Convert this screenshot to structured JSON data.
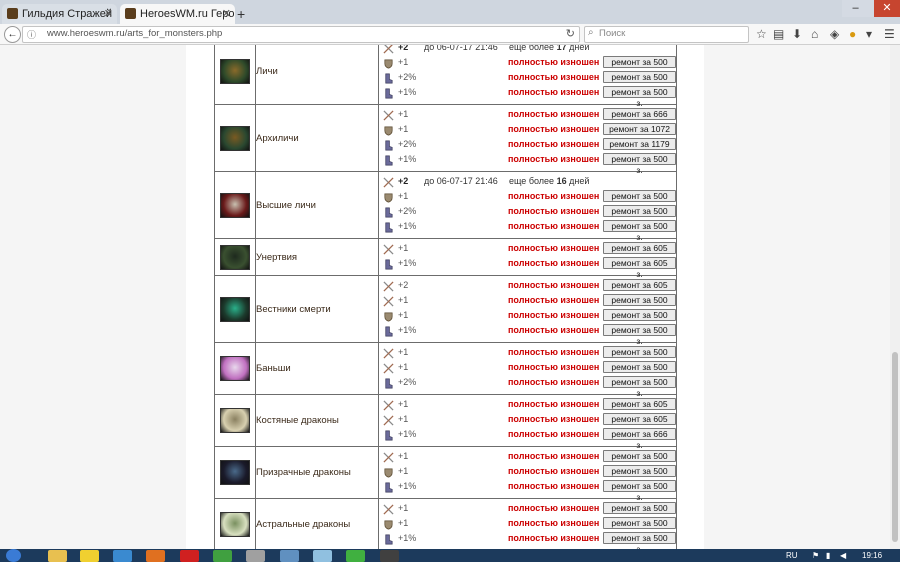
{
  "browser": {
    "tabs": [
      {
        "label": "Гильдия Стражей"
      },
      {
        "label": "HeroesWM.ru Герои войны"
      }
    ],
    "url": "www.heroeswm.ru/arts_for_monsters.php",
    "search_placeholder": "Поиск"
  },
  "taskbar": {
    "lang": "RU",
    "time": "19:16"
  },
  "monsters": [
    {
      "name": "Личи",
      "colors": [
        "#2e4a2a",
        "#8a6a2a"
      ],
      "lines": [
        {
          "icon": "sword",
          "value": "+2",
          "bold": true,
          "date": "до 06-07-17 21:46",
          "more": "еще более",
          "days": "17",
          "days_unit": "дней"
        },
        {
          "icon": "shield",
          "value": "+1",
          "wear": "полностью изношен",
          "repair": "ремонт за 500 з."
        },
        {
          "icon": "boot",
          "value": "+2%",
          "wear": "полностью изношен",
          "repair": "ремонт за 500 з."
        },
        {
          "icon": "boot",
          "value": "+1%",
          "wear": "полностью изношен",
          "repair": "ремонт за 500 з."
        }
      ]
    },
    {
      "name": "Архиличи",
      "colors": [
        "#2a4830",
        "#7a5a22"
      ],
      "lines": [
        {
          "icon": "sword",
          "value": "+1",
          "wear": "полностью изношен",
          "repair": "ремонт за 666 з."
        },
        {
          "icon": "shield",
          "value": "+1",
          "wear": "полностью изношен",
          "repair": "ремонт за 1072 з."
        },
        {
          "icon": "boot",
          "value": "+2%",
          "wear": "полностью изношен",
          "repair": "ремонт за 1179 з."
        },
        {
          "icon": "boot",
          "value": "+1%",
          "wear": "полностью изношен",
          "repair": "ремонт за 500 з."
        }
      ]
    },
    {
      "name": "Высшие личи",
      "colors": [
        "#6a1a1a",
        "#c8c0b0"
      ],
      "lines": [
        {
          "icon": "sword",
          "value": "+2",
          "bold": true,
          "date": "до 06-07-17 21:46",
          "more": "еще более",
          "days": "16",
          "days_unit": "дней"
        },
        {
          "icon": "shield",
          "value": "+1",
          "wear": "полностью изношен",
          "repair": "ремонт за 500 з."
        },
        {
          "icon": "boot",
          "value": "+2%",
          "wear": "полностью изношен",
          "repair": "ремонт за 500 з."
        },
        {
          "icon": "boot",
          "value": "+1%",
          "wear": "полностью изношен",
          "repair": "ремонт за 500 з."
        }
      ]
    },
    {
      "name": "Унертвия",
      "colors": [
        "#3a5030",
        "#1e2a1e"
      ],
      "lines": [
        {
          "icon": "sword",
          "value": "+1",
          "wear": "полностью изношен",
          "repair": "ремонт за 605 з."
        },
        {
          "icon": "boot",
          "value": "+1%",
          "wear": "полностью изношен",
          "repair": "ремонт за 605 з."
        }
      ]
    },
    {
      "name": "Вестники смерти",
      "colors": [
        "#1c3a2c",
        "#2ab08a"
      ],
      "lines": [
        {
          "icon": "sword",
          "value": "+2",
          "wear": "полностью изношен",
          "repair": "ремонт за 605 з."
        },
        {
          "icon": "sword",
          "value": "+1",
          "wear": "полностью изношен",
          "repair": "ремонт за 500 з."
        },
        {
          "icon": "shield",
          "value": "+1",
          "wear": "полностью изношен",
          "repair": "ремонт за 500 з."
        },
        {
          "icon": "boot",
          "value": "+1%",
          "wear": "полностью изношен",
          "repair": "ремонт за 500 з."
        }
      ]
    },
    {
      "name": "Баньши",
      "colors": [
        "#c070c0",
        "#e8d8ec"
      ],
      "lines": [
        {
          "icon": "sword",
          "value": "+1",
          "wear": "полностью изношен",
          "repair": "ремонт за 500 з."
        },
        {
          "icon": "sword",
          "value": "+1",
          "wear": "полностью изношен",
          "repair": "ремонт за 500 з."
        },
        {
          "icon": "boot",
          "value": "+2%",
          "wear": "полностью изношен",
          "repair": "ремонт за 500 з."
        }
      ]
    },
    {
      "name": "Костяные драконы",
      "colors": [
        "#d8d0b0",
        "#8a8060"
      ],
      "lines": [
        {
          "icon": "sword",
          "value": "+1",
          "wear": "полностью изношен",
          "repair": "ремонт за 605 з."
        },
        {
          "icon": "sword",
          "value": "+1",
          "wear": "полностью изношен",
          "repair": "ремонт за 605 з."
        },
        {
          "icon": "boot",
          "value": "+1%",
          "wear": "полностью изношен",
          "repair": "ремонт за 666 з."
        }
      ]
    },
    {
      "name": "Призрачные драконы",
      "colors": [
        "#1a1a2a",
        "#4a6a8a"
      ],
      "lines": [
        {
          "icon": "sword",
          "value": "+1",
          "wear": "полностью изношен",
          "repair": "ремонт за 500 з."
        },
        {
          "icon": "shield",
          "value": "+1",
          "wear": "полностью изношен",
          "repair": "ремонт за 500 з."
        },
        {
          "icon": "boot",
          "value": "+1%",
          "wear": "полностью изношен",
          "repair": "ремонт за 500 з."
        }
      ]
    },
    {
      "name": "Астральные драконы",
      "colors": [
        "#d8e0c0",
        "#7a9060"
      ],
      "lines": [
        {
          "icon": "sword",
          "value": "+1",
          "wear": "полностью изношен",
          "repair": "ремонт за 500 з."
        },
        {
          "icon": "shield",
          "value": "+1",
          "wear": "полностью изношен",
          "repair": "ремонт за 500 з."
        },
        {
          "icon": "boot",
          "value": "+1%",
          "wear": "полностью изношен",
          "repair": "ремонт за 500 з."
        }
      ]
    }
  ]
}
